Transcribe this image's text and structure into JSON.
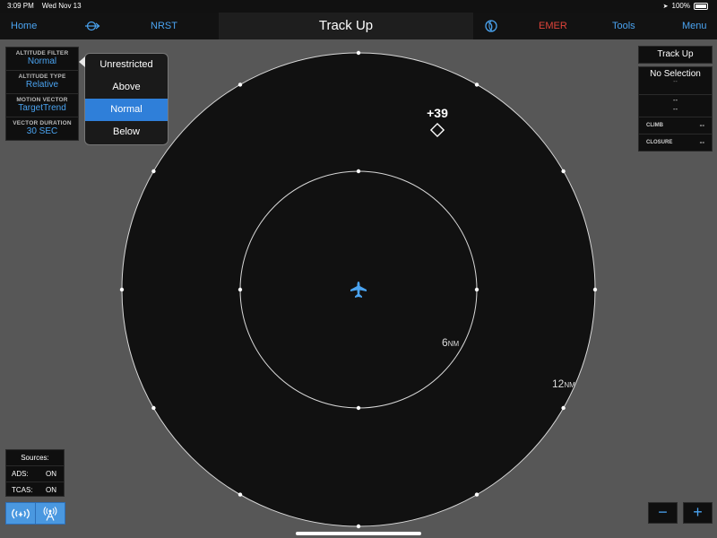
{
  "status_bar": {
    "time": "3:09 PM",
    "date": "Wed Nov 13",
    "battery": "100%"
  },
  "nav": {
    "home": "Home",
    "nrst": "NRST",
    "title": "Track Up",
    "emer": "EMER",
    "tools": "Tools",
    "menu": "Menu",
    "emer_color": "#e0443a",
    "accent_color": "#4aa3f0"
  },
  "filter_panel": {
    "altitude_filter": {
      "label": "ALTITUDE FILTER",
      "value": "Normal"
    },
    "altitude_type": {
      "label": "ALTITUDE TYPE",
      "value": "Relative"
    },
    "motion_vector": {
      "label": "MOTION VECTOR",
      "value": "TargetTrend"
    },
    "vector_duration": {
      "label": "VECTOR DURATION",
      "value": "30 SEC"
    }
  },
  "dropdown": {
    "options": [
      "Unrestricted",
      "Above",
      "Normal",
      "Below"
    ],
    "selected": "Normal"
  },
  "right_panel": {
    "orientation_button": "Track Up",
    "selection": "No Selection",
    "dash_1": "--",
    "dash_2": "--",
    "dash_3": "--",
    "climb_label": "CLIMB",
    "climb_value": "--",
    "closure_label": "CLOSURE",
    "closure_value": "--"
  },
  "radar": {
    "inner_range": "6",
    "outer_range": "12",
    "unit": "NM",
    "target_altitude": "+39",
    "ownship_color": "#4aa3f0"
  },
  "sources": {
    "title": "Sources:",
    "ads_label": "ADS:",
    "ads_value": "ON",
    "tcas_label": "TCAS:",
    "tcas_value": "ON"
  },
  "zoom": {
    "minus": "−",
    "plus": "+"
  },
  "icons": {
    "route": "route-icon",
    "globe": "globe-icon",
    "ads": "ads-signal-icon",
    "tcas": "tcas-antenna-icon",
    "ownship": "airplane-icon",
    "target": "diamond-target-icon"
  }
}
